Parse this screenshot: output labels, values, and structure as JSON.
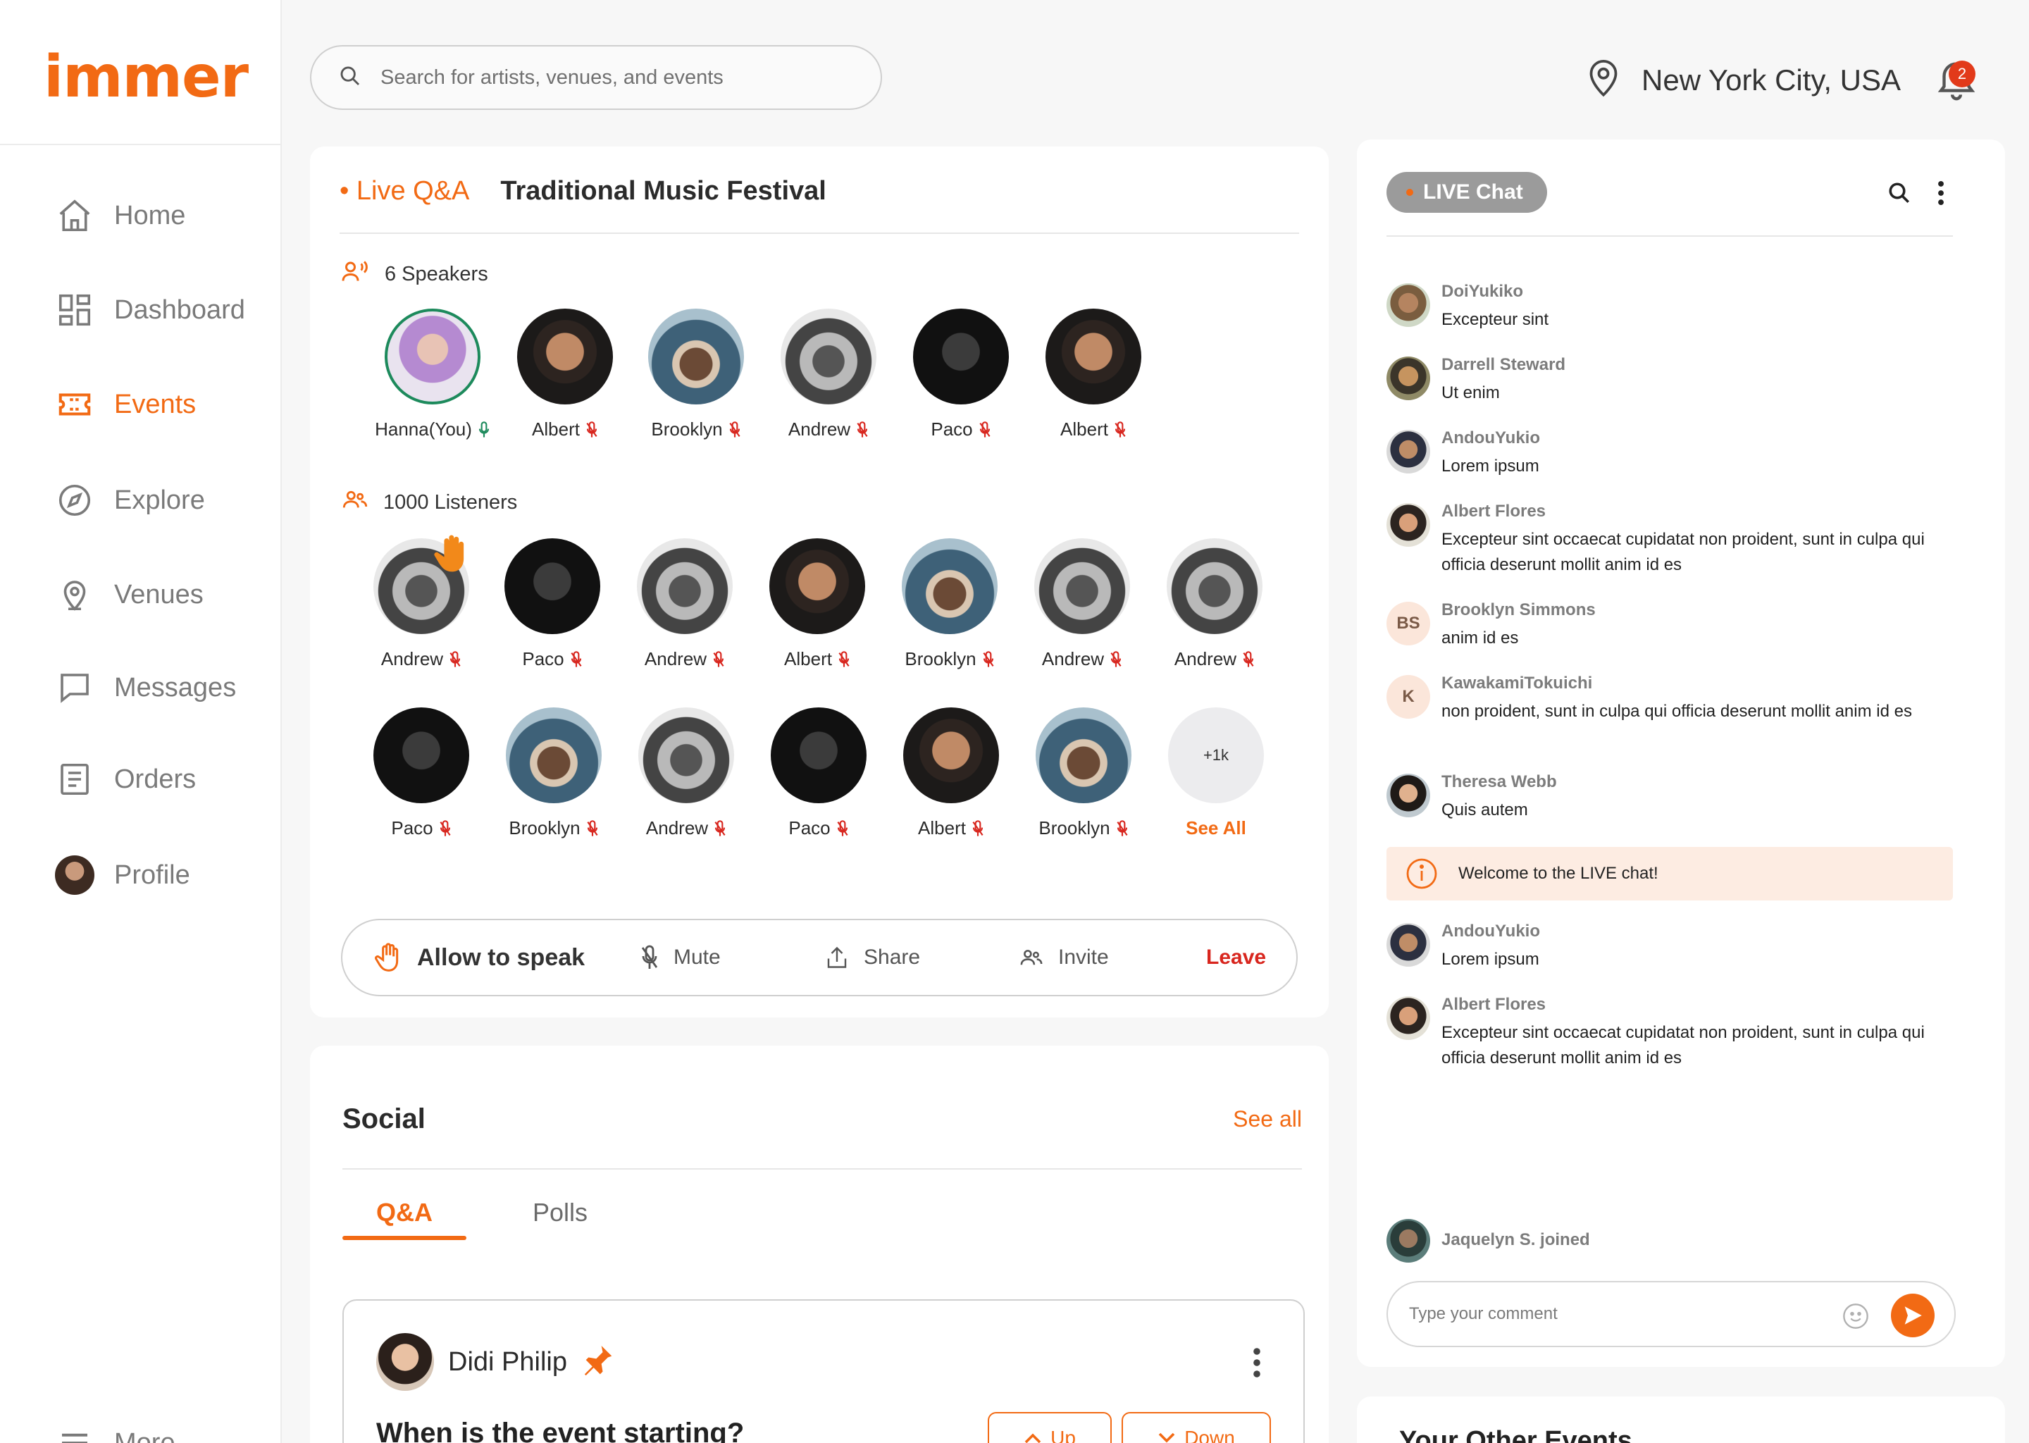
{
  "app": {
    "logo": "immer"
  },
  "sidebar": {
    "items": [
      {
        "label": "Home",
        "icon": "home-icon"
      },
      {
        "label": "Dashboard",
        "icon": "dashboard-icon"
      },
      {
        "label": "Events",
        "icon": "ticket-icon",
        "active": true
      },
      {
        "label": "Explore",
        "icon": "compass-icon"
      },
      {
        "label": "Venues",
        "icon": "location-pin-icon"
      },
      {
        "label": "Messages",
        "icon": "message-icon"
      },
      {
        "label": "Orders",
        "icon": "orders-icon"
      },
      {
        "label": "Profile",
        "icon": "avatar"
      }
    ],
    "more_label": "More"
  },
  "header": {
    "search_placeholder": "Search for artists, venues, and events",
    "location": "New York City, USA",
    "notification_count": "2"
  },
  "live": {
    "tag": "• Live Q&A",
    "title": "Traditional Music Festival",
    "speakers_label": "6 Speakers",
    "speakers": [
      {
        "name": "Hanna(You)",
        "mic": "on"
      },
      {
        "name": "Albert",
        "mic": "muted"
      },
      {
        "name": "Brooklyn",
        "mic": "muted"
      },
      {
        "name": "Andrew",
        "mic": "muted"
      },
      {
        "name": "Paco",
        "mic": "muted"
      },
      {
        "name": "Albert",
        "mic": "muted"
      }
    ],
    "listeners_label": "1000 Listeners",
    "listeners_row1": [
      {
        "name": "Andrew",
        "hand_raised": true
      },
      {
        "name": "Paco"
      },
      {
        "name": "Andrew"
      },
      {
        "name": "Albert"
      },
      {
        "name": "Brooklyn"
      },
      {
        "name": "Andrew"
      },
      {
        "name": "Andrew"
      }
    ],
    "listeners_row2": [
      {
        "name": "Paco"
      },
      {
        "name": "Brooklyn"
      },
      {
        "name": "Andrew"
      },
      {
        "name": "Paco"
      },
      {
        "name": "Albert"
      },
      {
        "name": "Brooklyn"
      }
    ],
    "more_count": "+1k",
    "see_all": "See All",
    "actions": {
      "allow": "Allow to speak",
      "mute": "Mute",
      "share": "Share",
      "invite": "Invite",
      "leave": "Leave"
    }
  },
  "social": {
    "title": "Social",
    "see_all": "See all",
    "tabs": [
      "Q&A",
      "Polls"
    ],
    "post": {
      "author": "Didi Philip",
      "question": "When is the event starting?",
      "up": "Up",
      "down": "Down"
    }
  },
  "chat": {
    "pill": "LIVE Chat",
    "messages": [
      {
        "name": "DoiYukiko",
        "text": "Excepteur sint"
      },
      {
        "name": "Darrell Steward",
        "text": "Ut enim"
      },
      {
        "name": "AndouYukio",
        "text": "Lorem ipsum"
      },
      {
        "name": "Albert Flores",
        "text": "Excepteur sint occaecat cupidatat non proident, sunt in culpa qui officia deserunt mollit anim id es"
      },
      {
        "name": "Brooklyn Simmons",
        "text": "anim id es",
        "initials": "BS"
      },
      {
        "name": "KawakamiTokuichi",
        "text": "non proident, sunt in culpa qui officia deserunt mollit anim id es",
        "initials": "K"
      },
      {
        "name": "Theresa Webb",
        "text": "Quis autem"
      }
    ],
    "welcome": "Welcome to the LIVE chat!",
    "messages_after": [
      {
        "name": "AndouYukio",
        "text": "Lorem ipsum"
      },
      {
        "name": "Albert Flores",
        "text": "Excepteur sint occaecat cupidatat non proident, sunt in culpa qui officia deserunt mollit anim id es"
      }
    ],
    "joined": "Jaquelyn S. joined",
    "comment_placeholder": "Type your comment"
  },
  "other_events": {
    "title": "Your Other Events"
  },
  "colors": {
    "accent": "#f26a14",
    "danger": "#d8261e",
    "success": "#1d8a5c",
    "info_bg": "#fdece2"
  }
}
